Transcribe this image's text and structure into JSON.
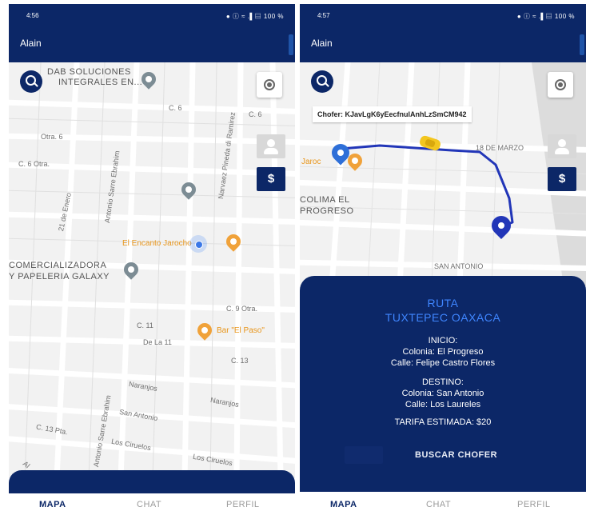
{
  "left": {
    "status": {
      "time": "4:56",
      "icons": "● ⓘ ≈ .▌▤ 100 %"
    },
    "appbar": {
      "user": "Alain"
    },
    "map_labels": {
      "poi_dab": "DAB SOLUCIONES",
      "poi_dab2": "INTEGRALES EN...",
      "c6a": "C. 6",
      "c6b": "C. 6",
      "otra6": "Otra. 6",
      "c6otra": "C. 6 Otra.",
      "antonio_sarre": "Antonio Sarre Ebrahim",
      "narvaez": "Narvaez Pineda di Ramirez",
      "enero": "21 de Enero",
      "encanto": "El Encanto Jarocho",
      "comercializadora": "COMERCIALIZADORA",
      "papeleria": "Y PAPELERIA GALAXY",
      "c9": "C. 9 Otra.",
      "c11": "C. 11",
      "dela11": "De La 11",
      "bar": "Bar \"El Paso\"",
      "c13": "C. 13",
      "naranjos1": "Naranjos",
      "naranjos2": "Naranjos",
      "san_antonio": "San Antonio",
      "c13pta": "C. 13 Pta.",
      "ciruelos1": "Los Ciruelos",
      "ciruelos2": "Los Ciruelos",
      "antonio_sarre2": "Antonio Sarre Ebrahim",
      "al": "Al"
    },
    "dollar": "$",
    "nav": {
      "mapa": "MAPA",
      "chat": "CHAT",
      "perfil": "PERFIL"
    }
  },
  "right": {
    "status": {
      "time": "4:57",
      "icons": "● ⓘ ≈ .▌▤ 100 %"
    },
    "appbar": {
      "user": "Alain"
    },
    "chofer": "Chofer: KJavLgK6yEecfnulAnhLzSmCM942",
    "map_labels": {
      "marzo": "18 DE MARZO",
      "jaroc": "Jaroc",
      "colima": "COLIMA EL",
      "progreso": "PROGRESO",
      "san_antonio": "SAN ANTONIO"
    },
    "dollar": "$",
    "route": {
      "title1": "RUTA",
      "title2": "TUXTEPEC OAXACA",
      "inicio": "INICIO:",
      "inicio_colonia": "Colonia: El Progreso",
      "inicio_calle": "Calle: Felipe Castro Flores",
      "destino": "DESTINO:",
      "destino_colonia": "Colonia: San Antonio",
      "destino_calle": "Calle: Los Laureles",
      "tarifa": "TARIFA ESTIMADA: $20",
      "buscar": "BUSCAR CHOFER"
    },
    "nav": {
      "mapa": "MAPA",
      "chat": "CHAT",
      "perfil": "PERFIL"
    }
  },
  "colors": {
    "navy": "#0c2767",
    "route_blue": "#2236b8",
    "title_blue": "#3f86ff",
    "poi_orange": "#f0a23a"
  }
}
